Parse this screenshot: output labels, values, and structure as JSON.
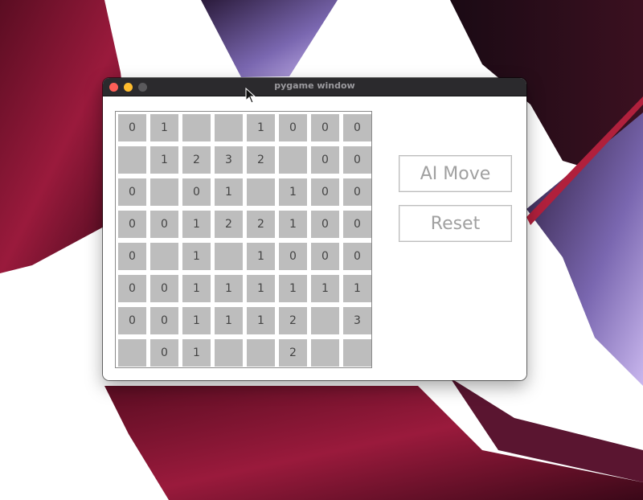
{
  "window": {
    "title": "pygame window"
  },
  "board": {
    "rows": [
      [
        "0",
        "1",
        "",
        "",
        "1",
        "0",
        "0",
        "0"
      ],
      [
        "",
        "1",
        "2",
        "3",
        "2",
        "",
        "0",
        "0"
      ],
      [
        "0",
        "",
        "0",
        "1",
        "",
        "1",
        "0",
        "0"
      ],
      [
        "0",
        "0",
        "1",
        "2",
        "2",
        "1",
        "0",
        "0"
      ],
      [
        "0",
        "",
        "1",
        "",
        "1",
        "0",
        "0",
        "0"
      ],
      [
        "0",
        "0",
        "1",
        "1",
        "1",
        "1",
        "1",
        "1"
      ],
      [
        "0",
        "0",
        "1",
        "1",
        "1",
        "2",
        "",
        "3"
      ],
      [
        "",
        "0",
        "1",
        "",
        "",
        "2",
        "",
        ""
      ]
    ]
  },
  "buttons": {
    "ai_move": "AI Move",
    "reset": "Reset"
  },
  "colors": {
    "cell": "#bdbdbd",
    "button_text": "#a0a0a0",
    "close": "#fe5f57",
    "minimize": "#febc2e"
  }
}
